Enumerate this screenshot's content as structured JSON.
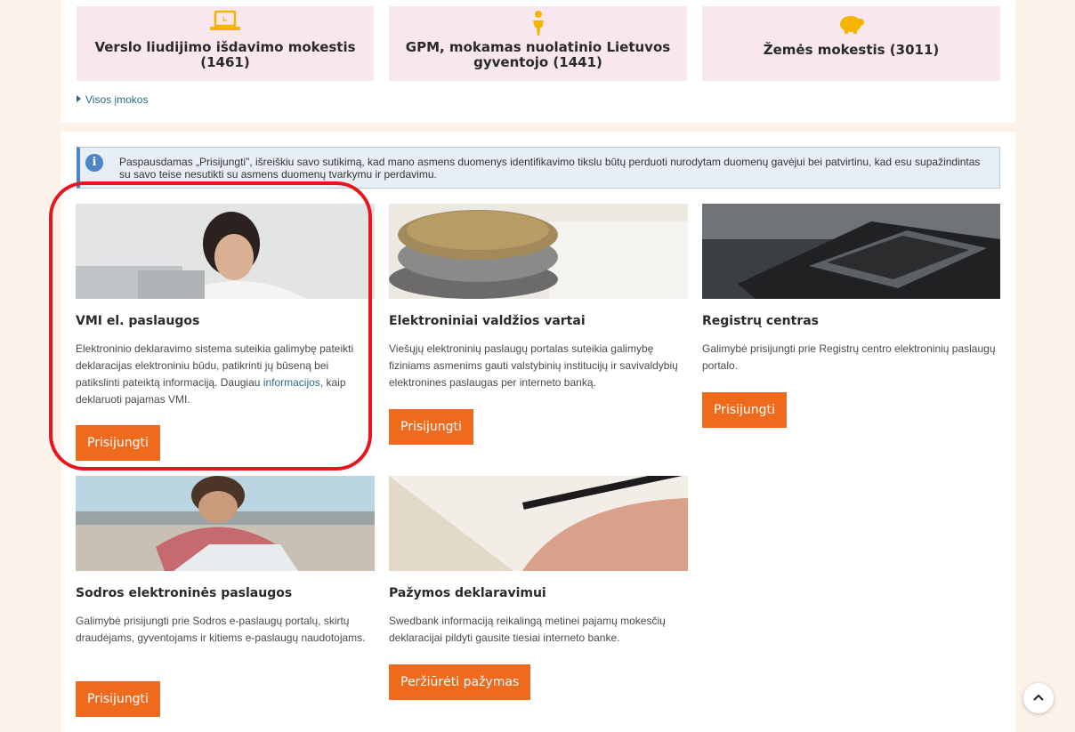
{
  "top_cards": [
    {
      "title": "Verslo liudijimo išdavimo mokestis (1461)",
      "icon": "laptop-icon"
    },
    {
      "title": "GPM, mokamas nuolatinio Lietuvos gyventojo (1441)",
      "icon": "person-icon"
    },
    {
      "title": "Žemės mokestis (3011)",
      "icon": "piggy-bank-icon"
    }
  ],
  "all_payments_link": "Visos įmokos",
  "info_text": "Paspausdamas „Prisijungti\", išreiškiu savo sutikimą, kad mano asmens duomenys identifikavimo tikslu būtų perduoti nurodytam duomenų gavėjui bei patvirtinu, kad esu supažindintas su savo teise nesutikti su asmens duomenų tvarkymu ir perdavimu.",
  "services": [
    {
      "title": "VMI el. paslaugos",
      "desc_before": "Elektroninio deklaravimo sistema suteikia galimybę pateikti deklaracijas elektroniniu būdu, patikrinti jų būseną bei patikslinti pateiktą informaciją. Daugiau ",
      "desc_link": "informacijos",
      "desc_after": ", kaip deklaruoti pajamas VMI.",
      "button": "Prisijungti"
    },
    {
      "title": "Elektroniniai valdžios vartai",
      "desc": "Viešųjų elektroninių paslaugų portalas suteikia galimybę fiziniams asmenims gauti valstybinių institucijų ir savivaldybių elektronines paslaugas per interneto banką.",
      "button": "Prisijungti"
    },
    {
      "title": "Registrų centras",
      "desc": "Galimybė prisijungti prie Registrų centro elektroninių paslaugų portalo.",
      "button": "Prisijungti"
    },
    {
      "title": "Sodros elektroninės paslaugos",
      "desc": "Galimybė prisijungti prie Sodros e-paslaugų portalų, skirtų draudėjams, gyventojams ir kitiems e-paslaugų naudotojams.",
      "button": "Prisijungti"
    },
    {
      "title": "Pažymos deklaravimui",
      "desc": "Swedbank informaciją reikalingą metinei pajamų mokesčių deklaracijai pildyti gausite tiesiai interneto banke.",
      "button": "Peržiūrėti pažymas"
    }
  ],
  "colors": {
    "accent": "#f06a1e",
    "highlight": "#e8141e",
    "link": "#2d6a86",
    "card_bg": "#f8e7ef"
  }
}
